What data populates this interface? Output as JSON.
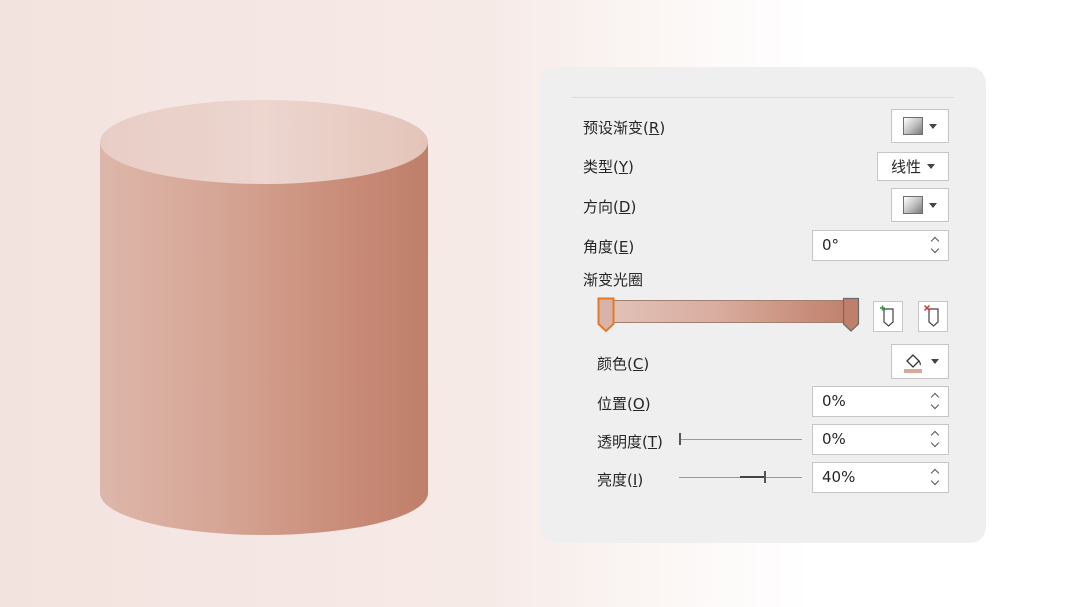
{
  "canvas": {
    "shape": "cylinder",
    "fill_colors": [
      "#ddb7aa",
      "#d6a696",
      "#c98c78",
      "#bf7f6a"
    ],
    "top_colors": [
      "#e8cdc5",
      "#ecd6cf",
      "#e4c4b9"
    ]
  },
  "panel": {
    "preset_gradient": {
      "label": "预设渐变",
      "key": "R",
      "icon": "gradient-swatch-icon"
    },
    "type": {
      "label": "类型",
      "key": "Y",
      "value": "线性"
    },
    "direction": {
      "label": "方向",
      "key": "D",
      "icon": "gradient-direction-icon"
    },
    "angle": {
      "label": "角度",
      "key": "E",
      "value": "0°"
    },
    "gradient_stops": {
      "label": "渐变光圈",
      "stops": [
        {
          "position_pct": 0,
          "color": "#d9b3a7",
          "selected": true
        },
        {
          "position_pct": 100,
          "color": "#bf7f6a",
          "selected": false
        }
      ],
      "add_stop_icon": "add-gradient-stop-icon",
      "remove_stop_icon": "remove-gradient-stop-icon"
    },
    "color": {
      "label": "颜色",
      "key": "C",
      "icon": "paint-bucket-icon",
      "swatch": "#d9a99a"
    },
    "position": {
      "label": "位置",
      "key": "O",
      "value": "0%"
    },
    "transparency": {
      "label": "透明度",
      "key": "T",
      "value": "0%",
      "level_pct": 0
    },
    "brightness": {
      "label": "亮度",
      "key": "I",
      "value": "40%",
      "level_pct": 70
    }
  }
}
